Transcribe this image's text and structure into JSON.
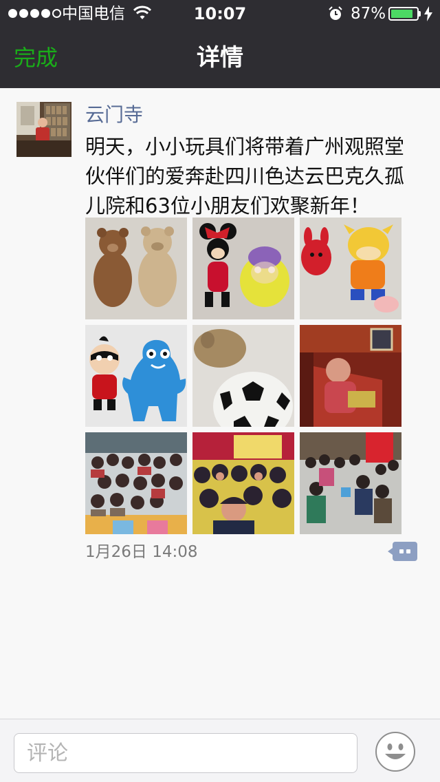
{
  "status_bar": {
    "carrier": "中国电信",
    "time": "10:07",
    "battery_percent": "87%",
    "battery_level": 0.87,
    "signal_bars": 4,
    "signal_total": 5
  },
  "nav": {
    "done_label": "完成",
    "title": "详情"
  },
  "post": {
    "username": "云门寺",
    "text": "明天，小小玩具们将带着广州观照堂伙伴们的爱奔赴四川色达云巴克久孤儿院和63位小朋友们欢聚新年！",
    "timestamp": "1月26日 14:08",
    "photos": [
      {
        "subject": "two teddy bears"
      },
      {
        "subject": "minnie mouse and yellow plush"
      },
      {
        "subject": "red and orange cow plush"
      },
      {
        "subject": "superhero plush and blue haibao"
      },
      {
        "subject": "plush toy and soccer ball"
      },
      {
        "subject": "child sleeping"
      },
      {
        "subject": "group of children"
      },
      {
        "subject": "children in classroom"
      },
      {
        "subject": "children outdoors"
      }
    ]
  },
  "comment_bar": {
    "placeholder": "评论"
  },
  "colors": {
    "nav_bg": "#2e2d32",
    "accent_green": "#1aad19",
    "username_blue": "#576b95",
    "battery_green": "#4cd964"
  }
}
